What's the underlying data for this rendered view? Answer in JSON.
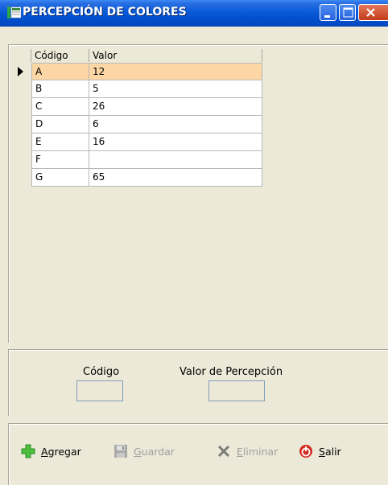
{
  "window": {
    "title": "PERCEPCIÓN DE COLORES"
  },
  "grid": {
    "columns": [
      "Código",
      "Valor"
    ],
    "rows": [
      {
        "codigo": "A",
        "valor": "12",
        "selected": true
      },
      {
        "codigo": "B",
        "valor": "5"
      },
      {
        "codigo": "C",
        "valor": "26"
      },
      {
        "codigo": "D",
        "valor": "6"
      },
      {
        "codigo": "E",
        "valor": "16"
      },
      {
        "codigo": "F",
        "valor": ""
      },
      {
        "codigo": "G",
        "valor": "65"
      }
    ]
  },
  "form": {
    "codigo_label": "Código",
    "codigo_value": "",
    "valor_label": "Valor de Percepción",
    "valor_value": ""
  },
  "toolbar": {
    "agregar_label": "Agregar",
    "guardar_label": "Guardar",
    "eliminar_label": "Eliminar",
    "salir_label": "Salir"
  },
  "icons": {
    "app": "app-icon",
    "minimize": "minimize-icon",
    "maximize": "maximize-icon",
    "close": "close-icon",
    "agregar": "plus-icon",
    "guardar": "floppy-disk-icon",
    "eliminar": "x-icon",
    "salir": "power-icon"
  },
  "colors": {
    "titlebar": "#0A5BD8",
    "selected_row": "#FCD6A4",
    "window_bg": "#ECE9D8",
    "add_green": "#3BA83B",
    "exit_red": "#D42A1E"
  }
}
